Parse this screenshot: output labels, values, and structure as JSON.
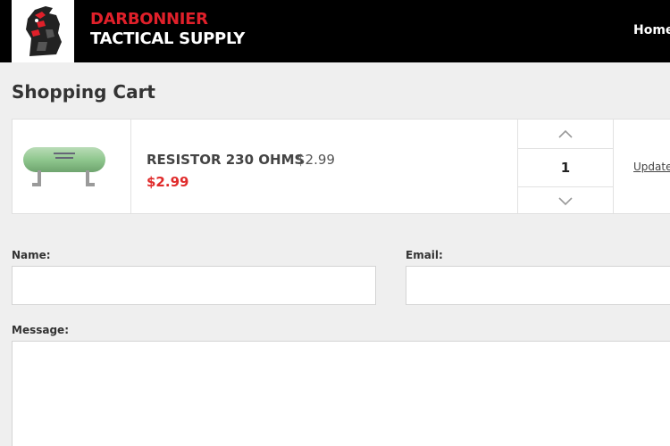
{
  "header": {
    "brand_line1": "DARBONNIER",
    "brand_line2": "TACTICAL SUPPLY",
    "nav_home": "Home"
  },
  "page": {
    "title": "Shopping Cart"
  },
  "cart": {
    "items": [
      {
        "name": "RESISTOR 230 OHMS",
        "unit_price": "$2.99",
        "total_price": "$2.99",
        "quantity": "1",
        "update_label": "Update"
      }
    ]
  },
  "form": {
    "name_label": "Name:",
    "name_value": "",
    "email_label": "Email:",
    "email_value": "",
    "message_label": "Message:",
    "message_value": ""
  },
  "colors": {
    "header_bg": "#000000",
    "brand_red": "#e0202a",
    "price_red": "#e02b2b",
    "page_bg": "#efefef"
  },
  "icons": {
    "logo": "horse-head-logo",
    "qty_up": "chevron-up-icon",
    "qty_down": "chevron-down-icon",
    "product": "resistor-product-image"
  }
}
